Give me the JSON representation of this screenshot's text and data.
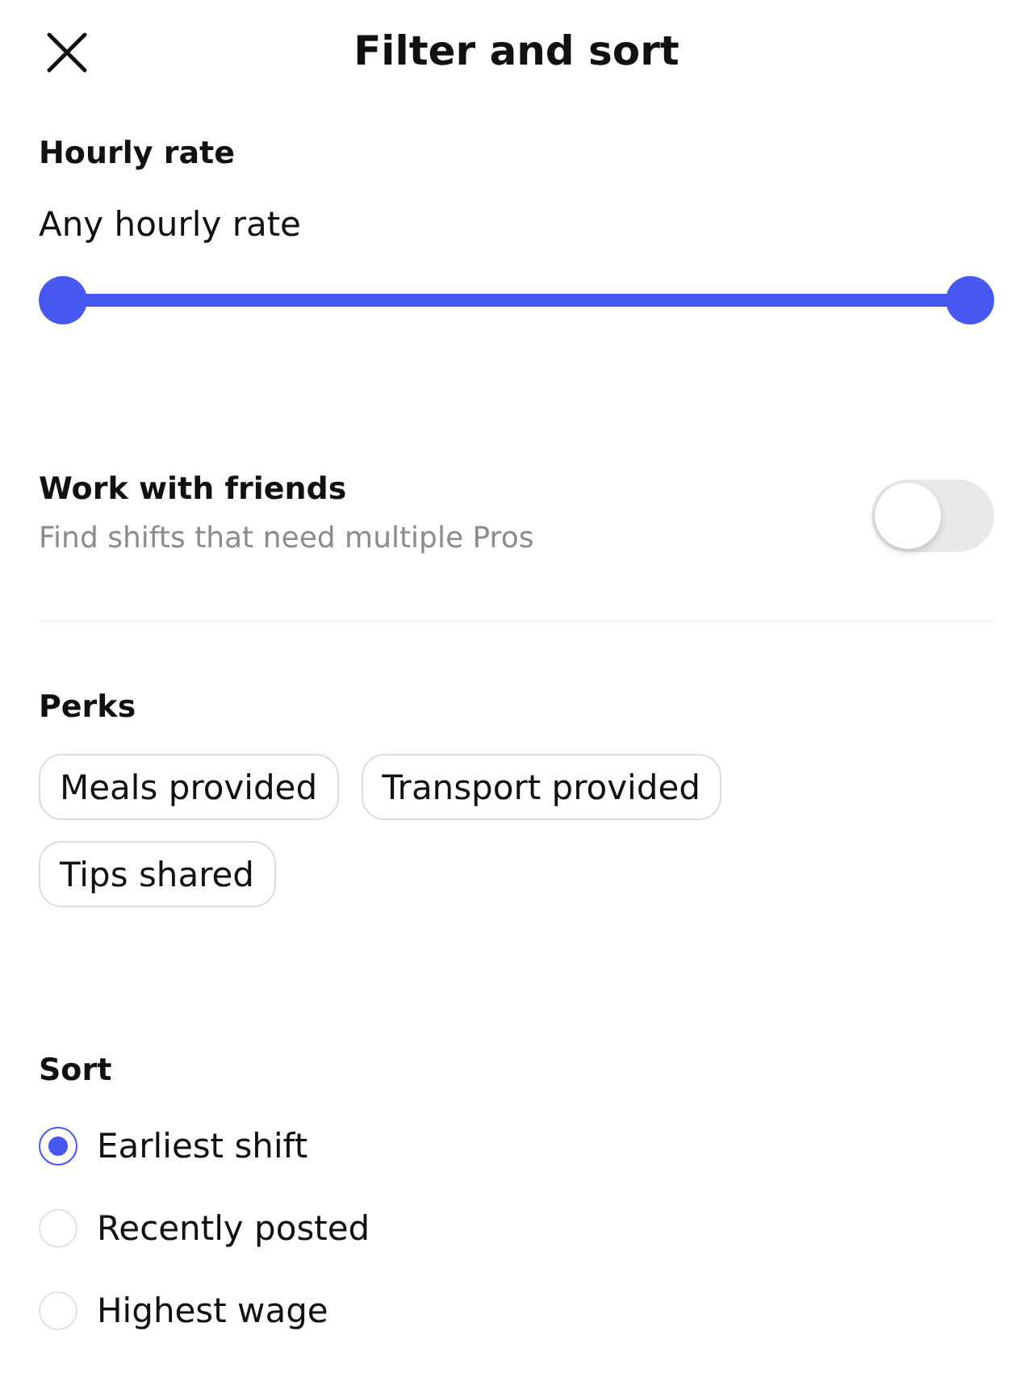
{
  "header": {
    "title": "Filter and sort"
  },
  "hourly_rate": {
    "heading": "Hourly rate",
    "value_text": "Any hourly rate",
    "slider": {
      "thumbs": [
        {
          "level": 0
        },
        {
          "level": 1
        }
      ]
    }
  },
  "work_with_friends": {
    "title": "Work with friends",
    "description": "Find shifts that need multiple Pros",
    "on": false
  },
  "perks": {
    "heading": "Perks",
    "options": [
      {
        "label": "Meals provided",
        "selected": false
      },
      {
        "label": "Transport provided",
        "selected": false
      },
      {
        "label": "Tips shared",
        "selected": false
      }
    ]
  },
  "sort": {
    "heading": "Sort",
    "options": [
      {
        "label": "Earliest shift",
        "selected": true
      },
      {
        "label": "Recently posted",
        "selected": false
      },
      {
        "label": "Highest wage",
        "selected": false
      }
    ]
  }
}
